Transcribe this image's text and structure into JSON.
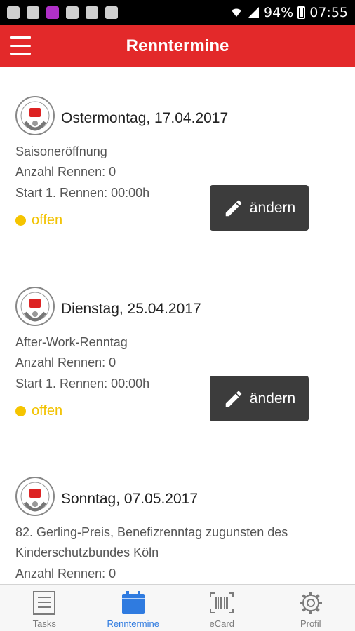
{
  "status_bar": {
    "battery": "94%",
    "time": "07:55",
    "notification_icons": [
      "image-icon",
      "podcast-icon",
      "camera-icon",
      "cards-icon",
      "cards-icon"
    ]
  },
  "app_bar": {
    "title": "Renntermine",
    "menu_icon": "hamburger-icon"
  },
  "race_days": [
    {
      "date": "Ostermontag, 17.04.2017",
      "name": "Saisoneröffnung",
      "races": "Anzahl Rennen: 0",
      "start": "Start 1. Rennen: 00:00h",
      "status": "offen",
      "button": "ändern"
    },
    {
      "date": "Dienstag, 25.04.2017",
      "name": "After-Work-Renntag",
      "races": "Anzahl Rennen: 0",
      "start": "Start 1. Rennen: 00:00h",
      "status": "offen",
      "button": "ändern"
    },
    {
      "date": "Sonntag, 07.05.2017",
      "name_line1": "82. Gerling-Preis, Benefizrenntag zugunsten des",
      "name_line2": "Kinderschutzbundes Köln",
      "races": "Anzahl Rennen: 0"
    }
  ],
  "bottom_nav": {
    "items": [
      {
        "label": "Tasks",
        "icon": "list-icon"
      },
      {
        "label": "Renntermine",
        "icon": "calendar-icon",
        "active": true
      },
      {
        "label": "eCard",
        "icon": "barcode-icon"
      },
      {
        "label": "Profil",
        "icon": "gear-icon"
      }
    ]
  },
  "colors": {
    "primary_red": "#e3292a",
    "status_yellow": "#f5c400",
    "active_blue": "#2f7be0",
    "button_dark": "#3c3c3c"
  }
}
